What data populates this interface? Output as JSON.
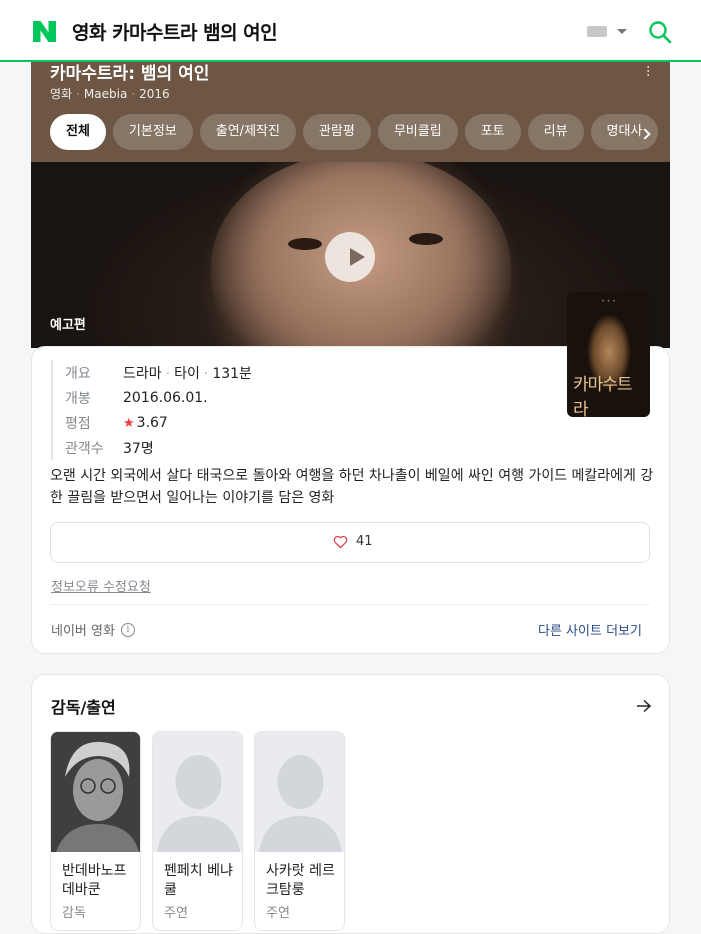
{
  "header": {
    "query": "영화 카마수트라 뱀의 여인"
  },
  "movie": {
    "title": "카마수트라: 뱀의 여인",
    "category": "영화",
    "original_title": "Maebia",
    "year": "2016",
    "trailer_label": "예고편",
    "tabs": [
      "전체",
      "기본정보",
      "출연/제작진",
      "관람평",
      "무비클립",
      "포토",
      "리뷰",
      "명대사"
    ]
  },
  "info": {
    "rows": [
      {
        "label": "개요",
        "genre": "드라마",
        "country": "타이",
        "runtime": "131분"
      },
      {
        "label": "개봉",
        "value": "2016.06.01."
      },
      {
        "label": "평점",
        "star": "★",
        "value": "3.67"
      },
      {
        "label": "관객수",
        "value": "37명"
      }
    ],
    "synopsis": "오랜 시간 외국에서 살다 태국으로 돌아와 여행을 하던 차나촐이 베일에 싸인 여행 가이드 메칼라에게 강한 끌림을 받으면서 일어나는 이야기를 담은 영화",
    "likes": "41",
    "report_link": "정보오류 수정요청",
    "source": "네이버 영화",
    "info_icon_glyph": "i",
    "more_sites": "다른 사이트 더보기",
    "poster_text": "카마수트라"
  },
  "cast": {
    "title": "감독/출연",
    "people": [
      {
        "name": "반데바노프 데바쿤",
        "role": "감독"
      },
      {
        "name": "펜페치 베냐쿨",
        "role": "주연"
      },
      {
        "name": "사카랏 레르크탐룽",
        "role": "주연"
      }
    ]
  },
  "colors": {
    "brand_green": "#03c75a",
    "star_red": "#f23d3d",
    "link_blue": "#2b4a88"
  }
}
